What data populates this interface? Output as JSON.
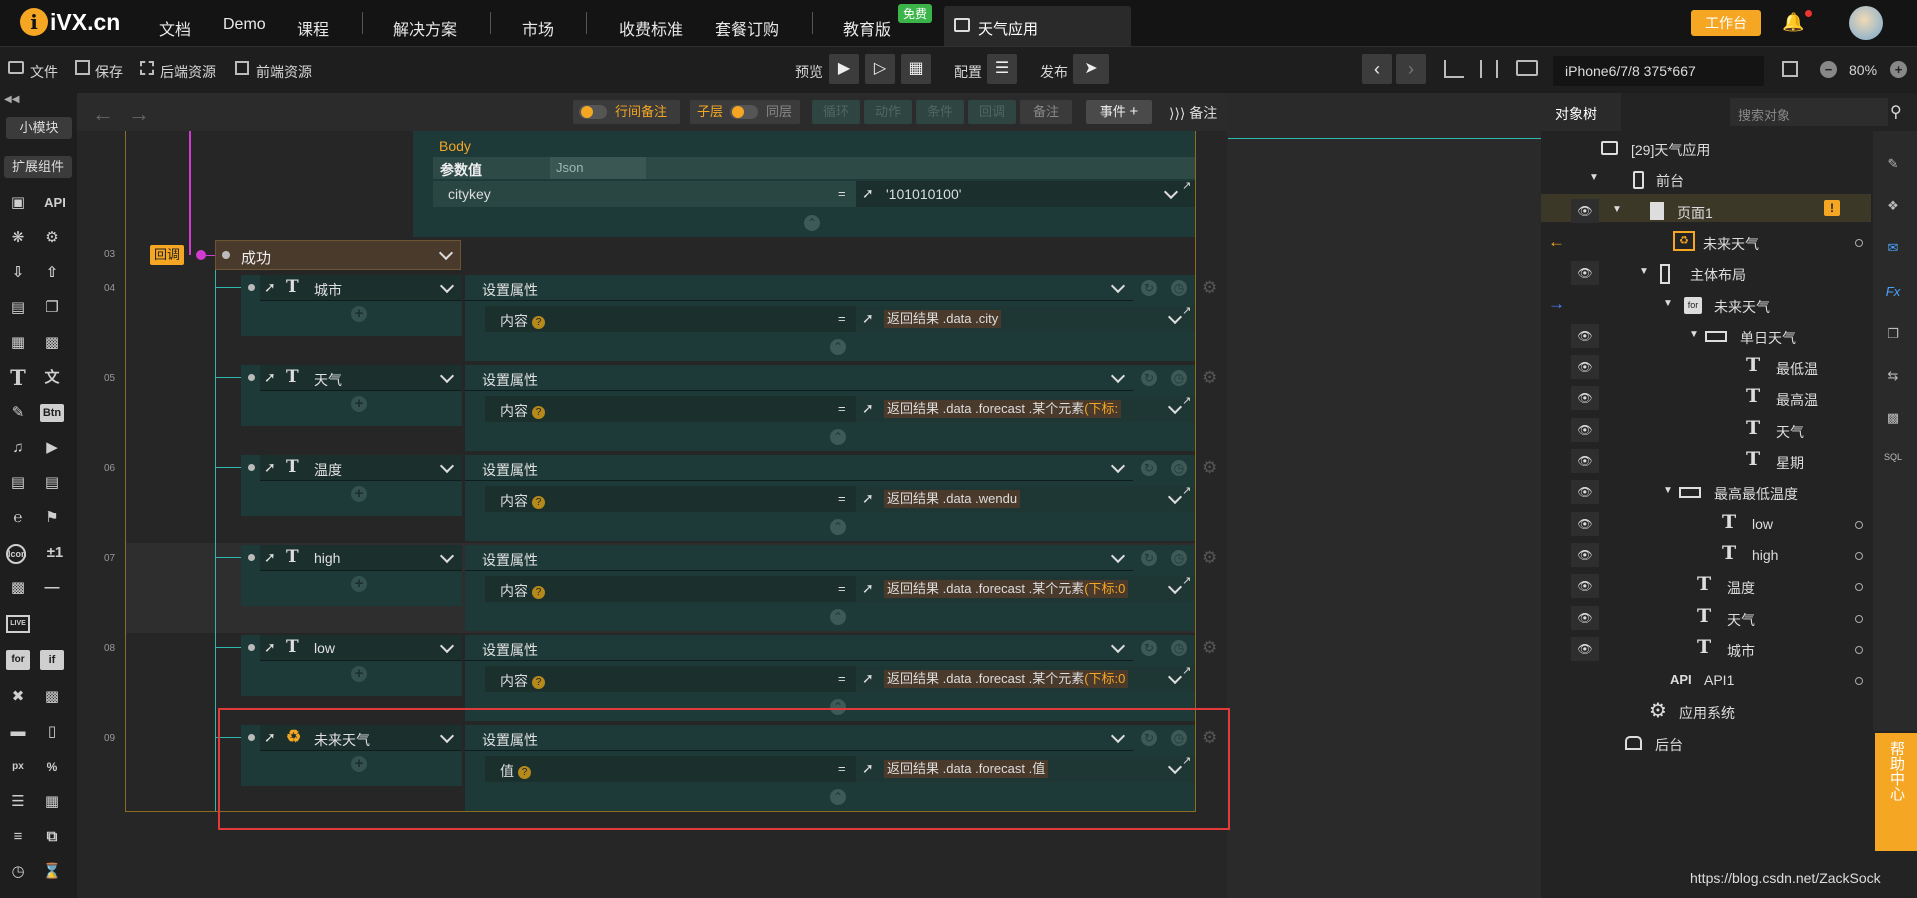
{
  "topbar": {
    "logo": "iVX.cn",
    "nav": [
      "文档",
      "Demo",
      "课程",
      "解决方案",
      "市场",
      "收费标准",
      "套餐订购",
      "教育版"
    ],
    "free_badge": "免费",
    "active_tab": "天气应用",
    "workbench_button": "工作台"
  },
  "toolbar": {
    "file": "文件",
    "save": "保存",
    "backend_res": "后端资源",
    "frontend_res": "前端资源",
    "preview": "预览",
    "config": "配置",
    "publish": "发布",
    "device": "iPhone6/7/8 375*667",
    "zoom": "80%"
  },
  "leftbar": {
    "small_modules": "小模块",
    "extend_components": "扩展组件",
    "api": "API",
    "btn": "Btn",
    "icon": "Icon",
    "live": "LIVE",
    "for": "for",
    "if": "if",
    "px": "px",
    "pct": "%",
    "plusminus": "±1"
  },
  "canvas_header": {
    "inline_note": "行间备注",
    "child_layer": "子层",
    "same_layer": "同层",
    "loop": "循环",
    "action": "动作",
    "condition": "条件",
    "callback": "回调",
    "note": "备注",
    "event": "事件",
    "notes": "备注"
  },
  "request": {
    "body_label": "Body",
    "param_value": "参数值",
    "json": "Json",
    "key": "citykey",
    "eq": "=",
    "value": "'101010100'"
  },
  "callback": {
    "line": "03",
    "label": "回调",
    "status": "成功"
  },
  "actions": [
    {
      "line": "04",
      "target": "城市",
      "action": "设置属性",
      "prop": "内容",
      "value": "返回结果 .data .city",
      "suffix": ""
    },
    {
      "line": "05",
      "target": "天气",
      "action": "设置属性",
      "prop": "内容",
      "value": "返回结果 .data .forecast .某个元素",
      "suffix": "(下标:"
    },
    {
      "line": "06",
      "target": "温度",
      "action": "设置属性",
      "prop": "内容",
      "value": "返回结果 .data .wendu",
      "suffix": ""
    },
    {
      "line": "07",
      "target": "high",
      "action": "设置属性",
      "prop": "内容",
      "value": "返回结果 .data .forecast .某个元素",
      "suffix": "(下标:0"
    },
    {
      "line": "08",
      "target": "low",
      "action": "设置属性",
      "prop": "内容",
      "value": "返回结果 .data .forecast .某个元素",
      "suffix": "(下标:0"
    },
    {
      "line": "09",
      "target": "未来天气",
      "action": "设置属性",
      "prop": "值",
      "value": "返回结果 .data .forecast .值",
      "suffix": ""
    }
  ],
  "object_tree": {
    "tab": "对象树",
    "search_placeholder": "搜索对象",
    "items": [
      {
        "label": "[29]天气应用"
      },
      {
        "label": "前台"
      },
      {
        "label": "页面1"
      },
      {
        "label": "未来天气"
      },
      {
        "label": "主体布局"
      },
      {
        "label": "未来天气"
      },
      {
        "label": "单日天气"
      },
      {
        "label": "最低温"
      },
      {
        "label": "最高温"
      },
      {
        "label": "天气"
      },
      {
        "label": "星期"
      },
      {
        "label": "最高最低温度"
      },
      {
        "label": "low"
      },
      {
        "label": "high"
      },
      {
        "label": "温度"
      },
      {
        "label": "天气"
      },
      {
        "label": "城市"
      },
      {
        "label": "API1"
      },
      {
        "label": "应用系统"
      },
      {
        "label": "后台"
      }
    ],
    "api_prefix": "API"
  },
  "help": "帮助中心",
  "watermark": "https://blog.csdn.net/ZackSock",
  "colors": {
    "accent": "#f5a623",
    "card": "#1e3a38",
    "highlight_border": "#e03a3a"
  }
}
